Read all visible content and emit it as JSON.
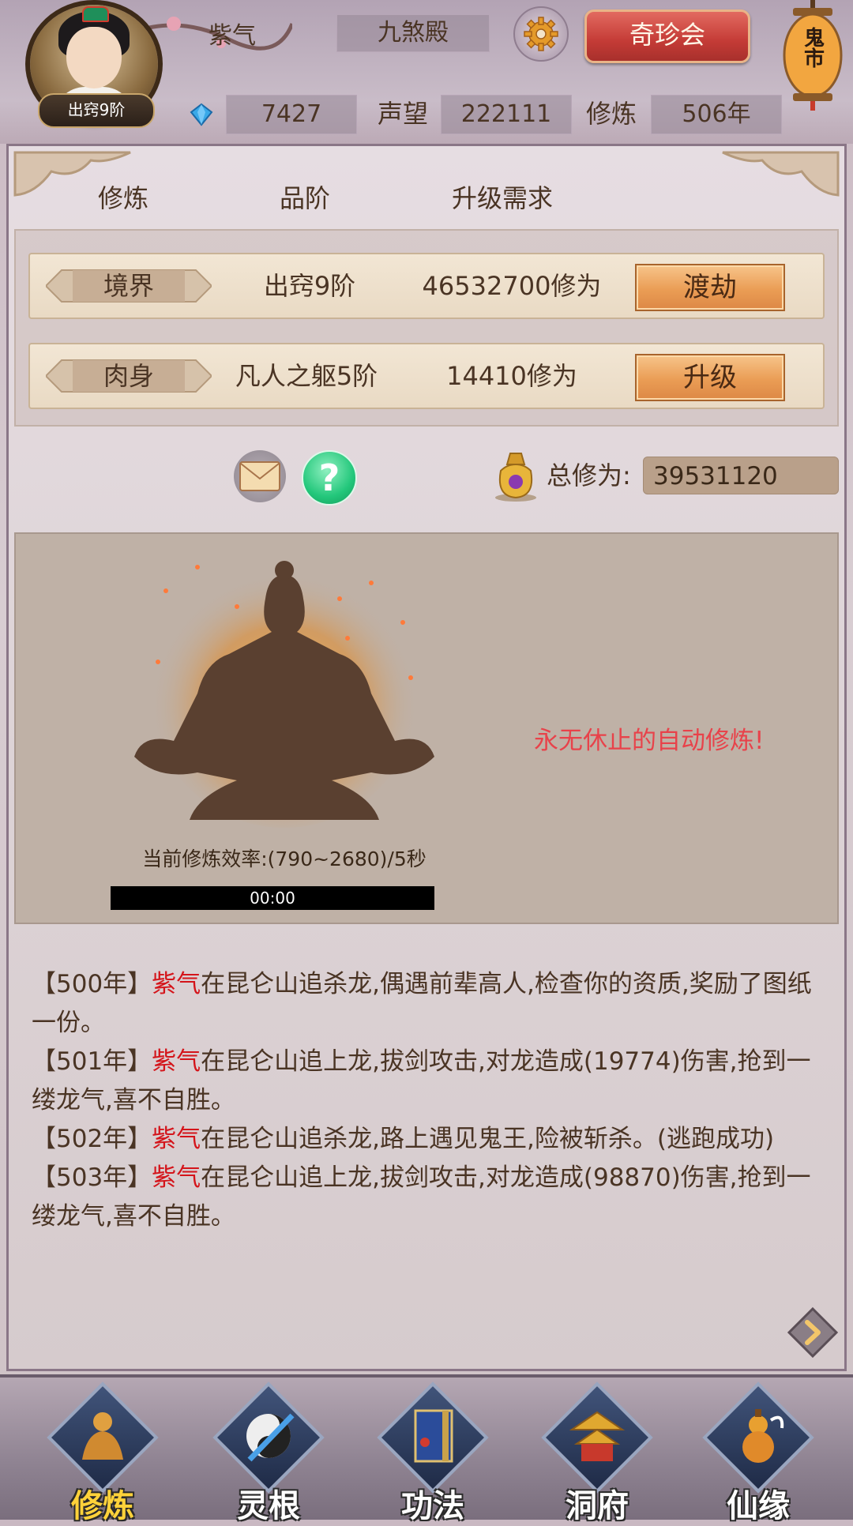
{
  "header": {
    "rank_badge": "出窍9阶",
    "player_name": "紫气",
    "faction": "九煞殿",
    "treasure_button": "奇珍会",
    "lantern_text": "鬼市",
    "gems": "7427",
    "prestige_label": "声望",
    "prestige_value": "222111",
    "cultivation_label": "修炼",
    "cultivation_years": "506年"
  },
  "columns": {
    "cultivate": "修炼",
    "grade": "品阶",
    "requirement": "升级需求"
  },
  "requirements": [
    {
      "tag": "境界",
      "grade": "出窍9阶",
      "cost": "46532700修为",
      "action": "渡劫"
    },
    {
      "tag": "肉身",
      "grade": "凡人之躯5阶",
      "cost": "14410修为",
      "action": "升级"
    }
  ],
  "totals": {
    "label": "总修为:",
    "value": "39531120"
  },
  "cultivation": {
    "efficiency": "当前修炼效率:(790~2680)/5秒",
    "timer": "00:00",
    "auto_text": "永无休止的自动修炼!"
  },
  "log": [
    {
      "prefix": "【500年】",
      "name": "紫气",
      "text": "在昆仑山追杀龙,偶遇前辈高人,检查你的资质,奖励了图纸一份。"
    },
    {
      "prefix": "【501年】",
      "name": "紫气",
      "text": "在昆仑山追上龙,拔剑攻击,对龙造成(19774)伤害,抢到一缕龙气,喜不自胜。"
    },
    {
      "prefix": "【502年】",
      "name": "紫气",
      "text": "在昆仑山追杀龙,路上遇见鬼王,险被斩杀。(逃跑成功)"
    },
    {
      "prefix": "【503年】",
      "name": "紫气",
      "text": "在昆仑山追上龙,拔剑攻击,对龙造成(98870)伤害,抢到一缕龙气,喜不自胜。"
    }
  ],
  "nav": [
    {
      "label": "修炼",
      "icon": "meditating-figure-icon",
      "active": true
    },
    {
      "label": "灵根",
      "icon": "spirit-root-sword-icon",
      "active": false
    },
    {
      "label": "功法",
      "icon": "scripture-book-icon",
      "active": false
    },
    {
      "label": "洞府",
      "icon": "pavilion-icon",
      "active": false
    },
    {
      "label": "仙缘",
      "icon": "gourd-icon",
      "active": false
    }
  ],
  "colors": {
    "accent_red": "#d4141a",
    "auto_text": "#e8424a",
    "button_orange": "#ea9d55",
    "nav_active": "#ffd23a"
  }
}
